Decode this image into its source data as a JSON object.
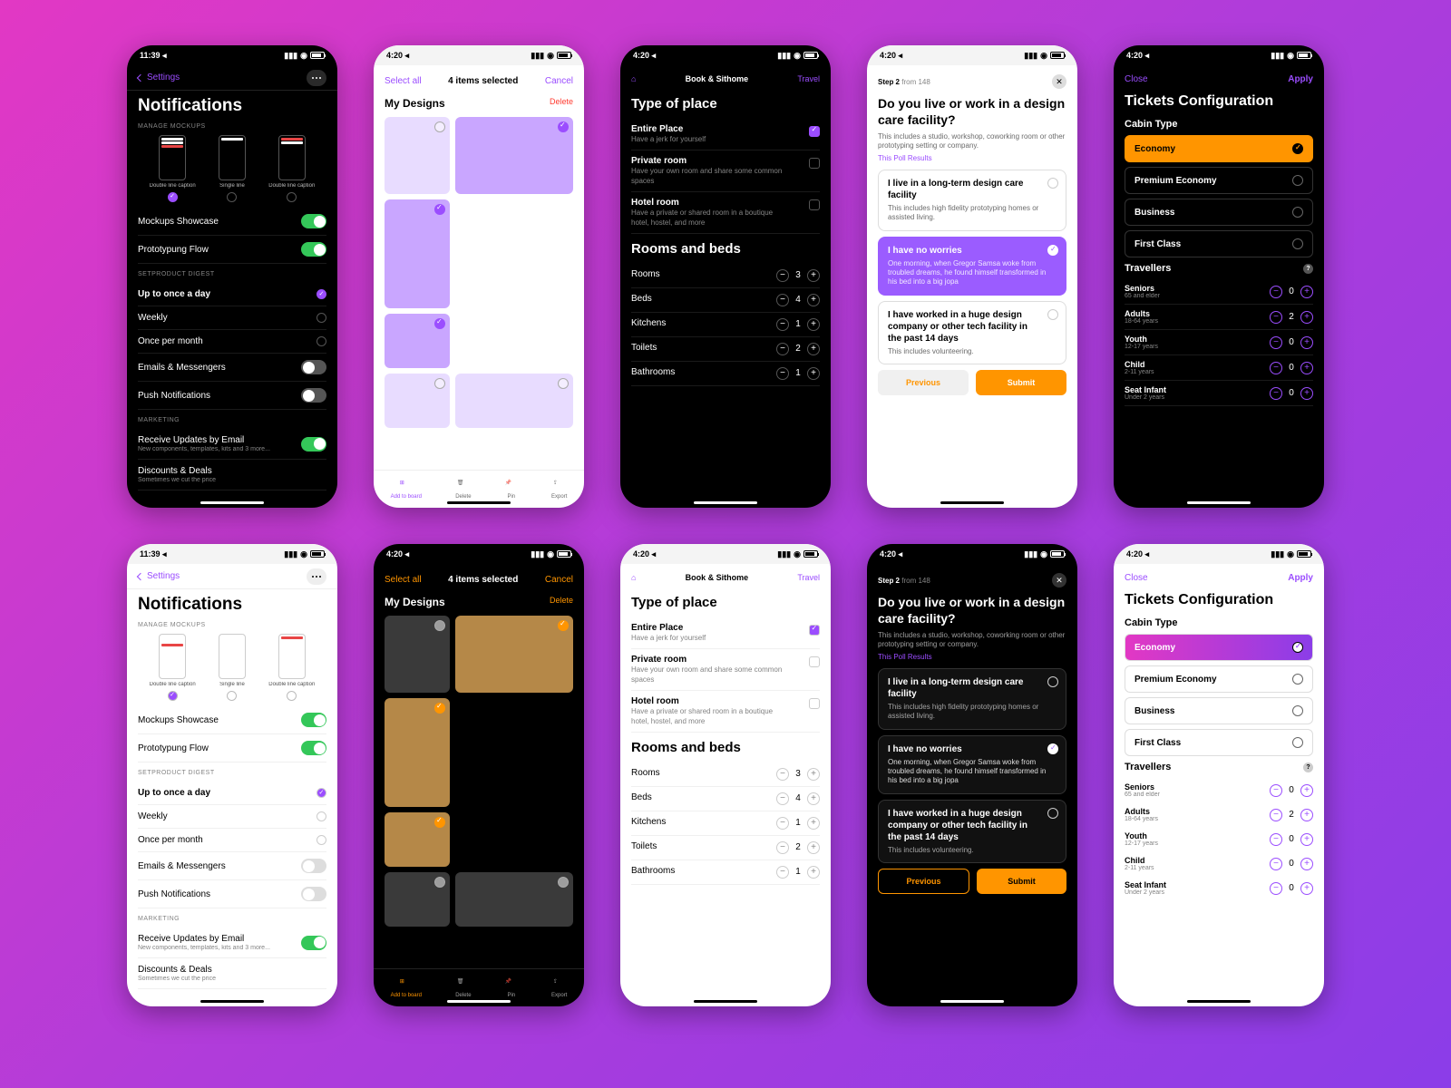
{
  "status": {
    "time1": "11:39",
    "time2": "4:20"
  },
  "s1": {
    "back": "Settings",
    "title": "Notifications",
    "sec1": "MANAGE MOCKUPS",
    "mocks": [
      {
        "cap": "Double line caption"
      },
      {
        "cap": "Single line"
      },
      {
        "cap": "Double line caption"
      }
    ],
    "rows1": [
      {
        "l": "Mockups Showcase",
        "on": true
      },
      {
        "l": "Prototypung Flow",
        "on": true
      }
    ],
    "sec2": "SETPRODUCT DIGEST",
    "rows2": [
      {
        "l": "Up to once a day",
        "sel": true
      },
      {
        "l": "Weekly"
      },
      {
        "l": "Once per month"
      },
      {
        "l": "Emails & Messengers",
        "tog": false
      },
      {
        "l": "Push Notifications",
        "tog": false
      }
    ],
    "sec3": "MARKETING",
    "rows3": [
      {
        "l": "Receive Updates by Email",
        "sub": "New components, templates, kits and 3 more...",
        "on": true
      },
      {
        "l": "Discounts & Deals",
        "sub": "Sometimes we cut the price"
      }
    ]
  },
  "s2": {
    "selectAll": "Select all",
    "count": "4 items selected",
    "cancel": "Cancel",
    "title": "My Designs",
    "delete": "Delete",
    "tabs": [
      {
        "l": "Add to board",
        "act": true
      },
      {
        "l": "Delete"
      },
      {
        "l": "Pin"
      },
      {
        "l": "Export"
      }
    ]
  },
  "s3": {
    "center": "Book & Sithome",
    "right": "Travel",
    "h1": "Type of place",
    "opts": [
      {
        "t": "Entire Place",
        "d": "Have a jerk for yourself",
        "sel": true
      },
      {
        "t": "Private room",
        "d": "Have your own room and share some common spaces"
      },
      {
        "t": "Hotel room",
        "d": "Have a private or shared room in a boutique hotel, hostel, and more"
      }
    ],
    "h2": "Rooms and beds",
    "counts": [
      {
        "l": "Rooms",
        "v": 3
      },
      {
        "l": "Beds",
        "v": 4
      },
      {
        "l": "Kitchens",
        "v": 1
      },
      {
        "l": "Toilets",
        "v": 2
      },
      {
        "l": "Bathrooms",
        "v": 1
      }
    ]
  },
  "s4": {
    "step": "Step 2",
    "from": "from 148",
    "q": "Do you live or work in a design care facility?",
    "sub": "This includes a studio, workshop, coworking room or other prototyping setting or company.",
    "link": "This Poll Results",
    "opts": [
      {
        "t": "I live in a long-term design care facility",
        "d": "This includes high fidelity prototyping homes or assisted living."
      },
      {
        "t": "I have no worries",
        "d": "One morning, when Gregor Samsa woke from troubled dreams, he found himself transformed in his bed into a big jopa",
        "sel": true
      },
      {
        "t": "I have  worked in a huge design company or other tech facility in the past 14 days",
        "d": "This includes volunteering."
      }
    ],
    "prev": "Previous",
    "submit": "Submit"
  },
  "s5": {
    "close": "Close",
    "apply": "Apply",
    "title": "Tickets Configuration",
    "cabinLbl": "Cabin Type",
    "cabins": [
      {
        "l": "Economy",
        "sel": true
      },
      {
        "l": "Premium Economy"
      },
      {
        "l": "Business"
      },
      {
        "l": "First Class"
      }
    ],
    "travLbl": "Travellers",
    "travs": [
      {
        "n": "Seniors",
        "d": "65 and elder",
        "v": 0
      },
      {
        "n": "Adults",
        "d": "18-64 years",
        "v": 2
      },
      {
        "n": "Youth",
        "d": "12-17 years",
        "v": 0
      },
      {
        "n": "Child",
        "d": "2-11 years",
        "v": 0
      },
      {
        "n": "Seat Infant",
        "d": "Under 2 years",
        "v": 0
      }
    ]
  }
}
